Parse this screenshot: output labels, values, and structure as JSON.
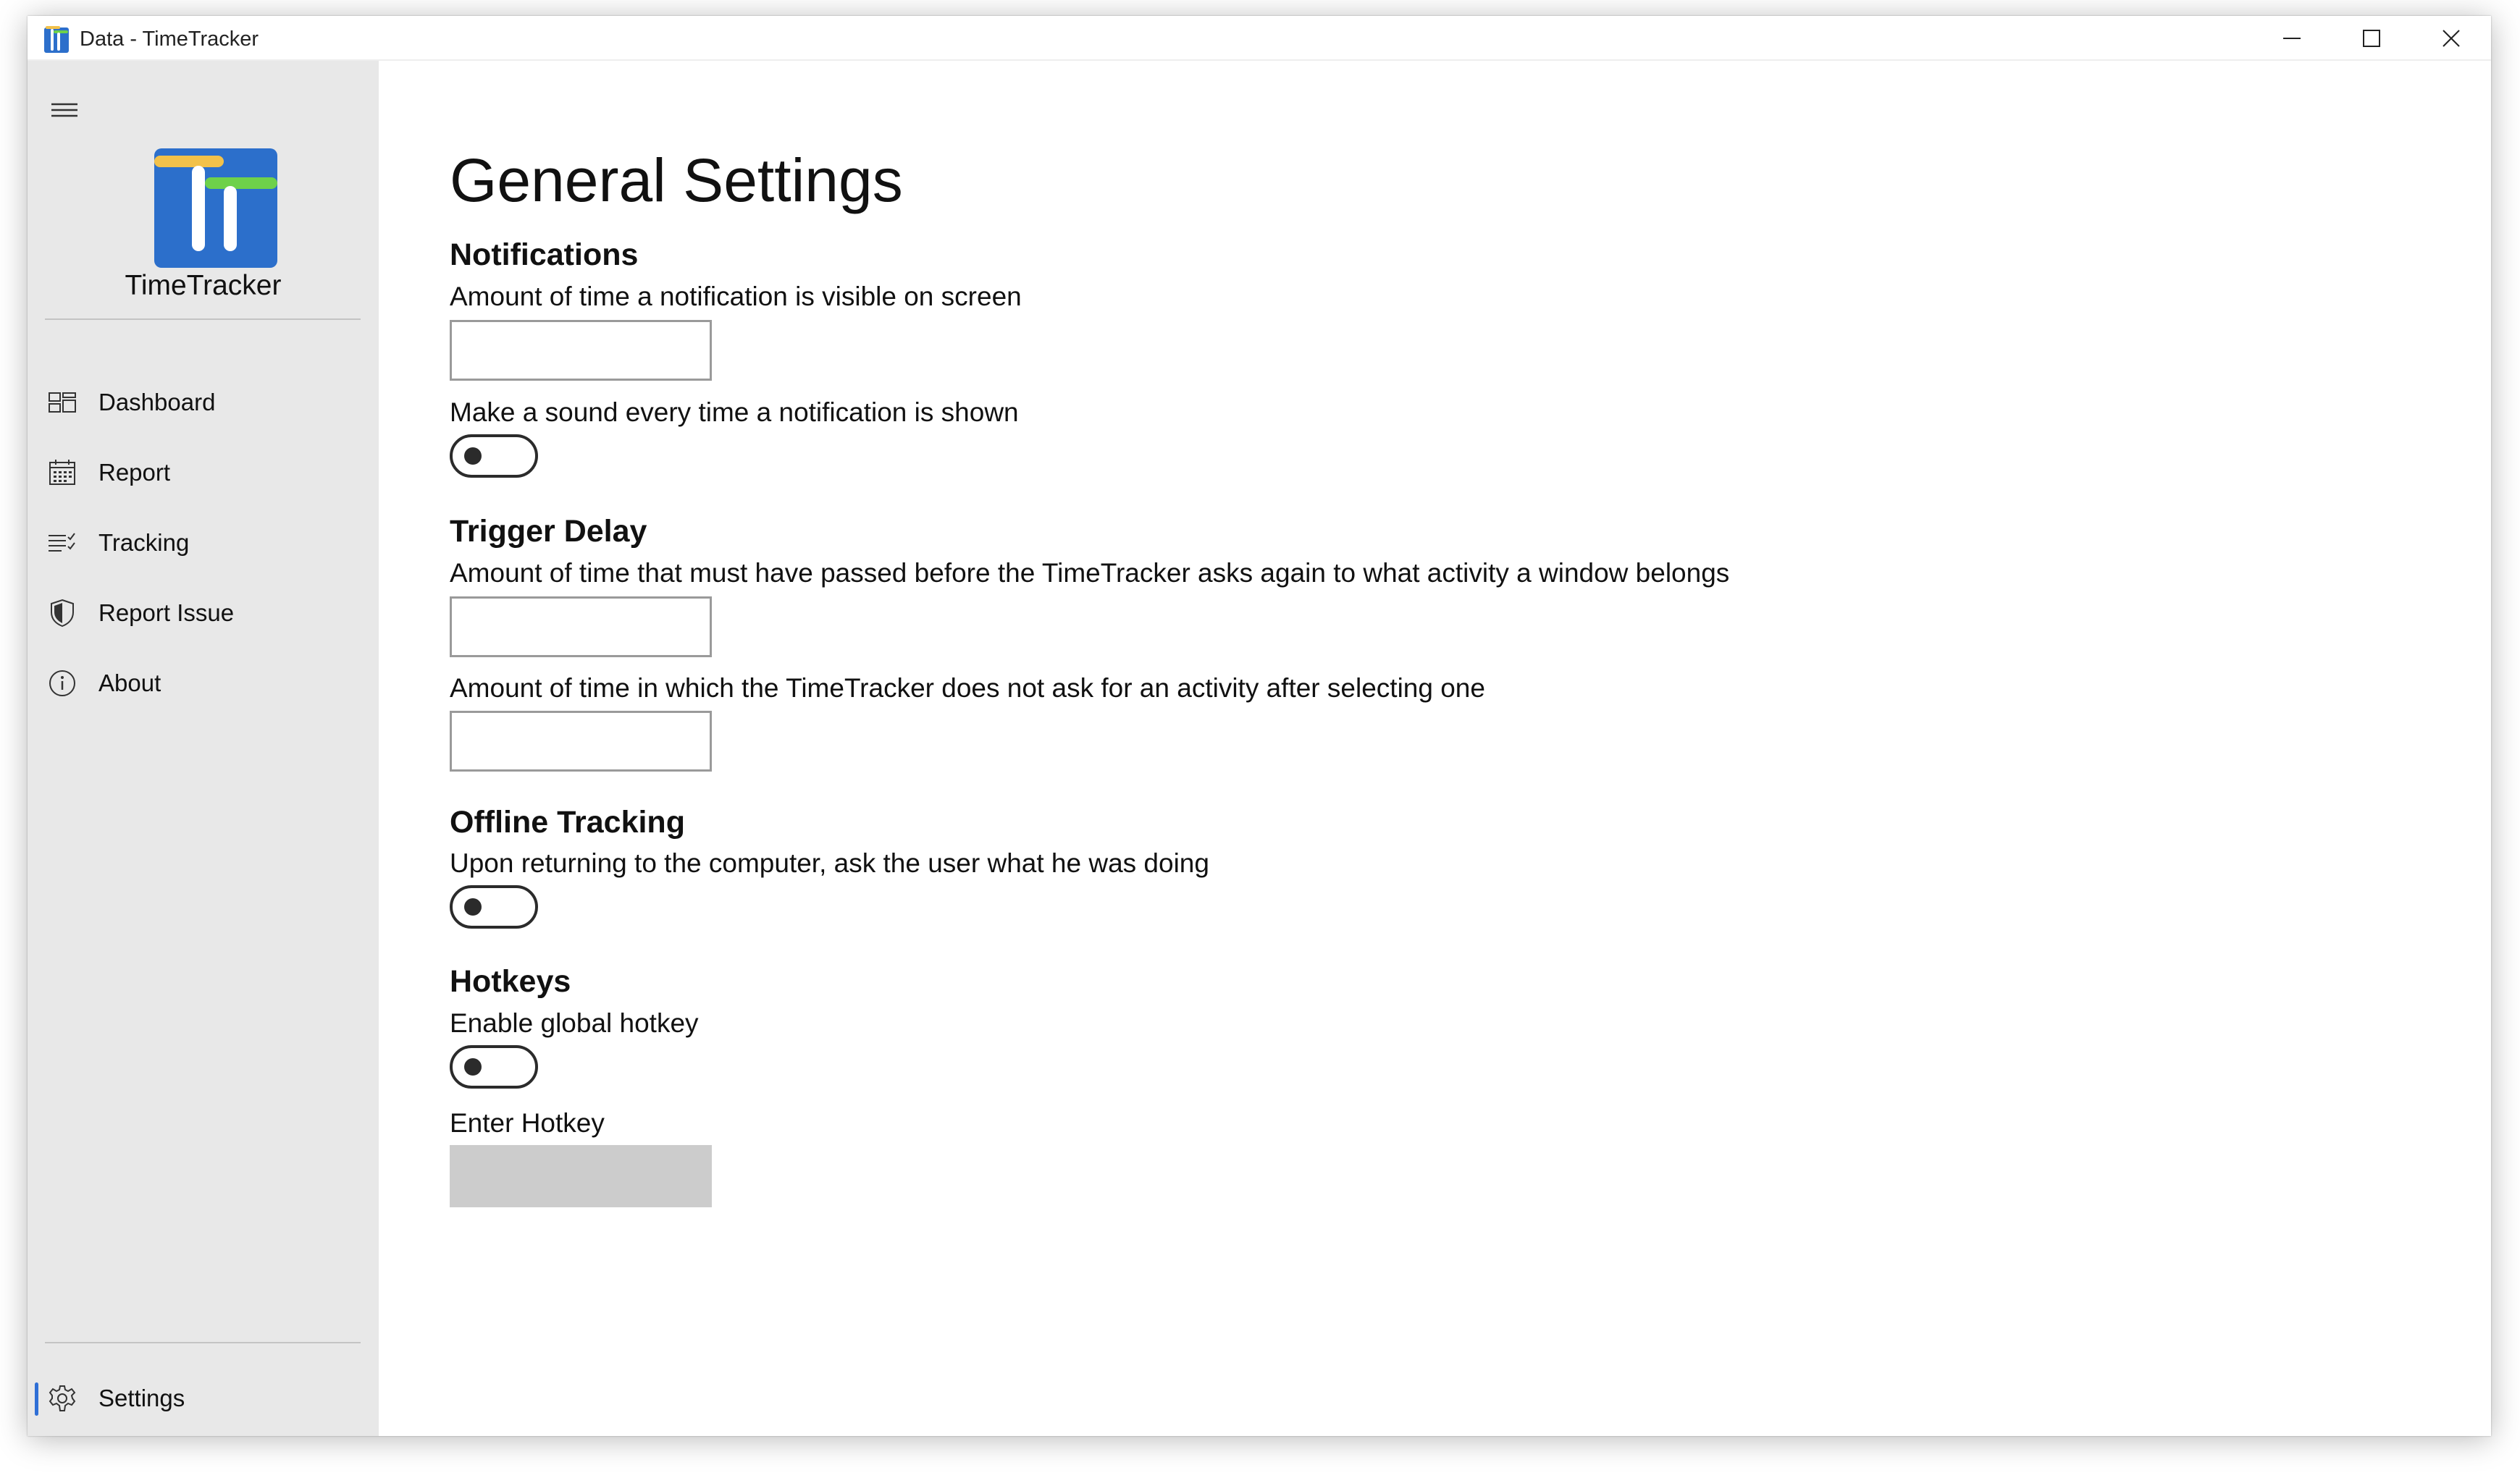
{
  "window": {
    "title": "Data - TimeTracker",
    "controls": {
      "minimize_icon": "minimize-icon",
      "maximize_icon": "maximize-icon",
      "close_icon": "close-icon"
    }
  },
  "colors": {
    "sidebar_bg": "#e8e8e8",
    "accent": "#2f6fd6",
    "logo_blue": "#2c6fcb",
    "logo_yellow": "#f2c14a",
    "logo_green": "#6ed14a",
    "hotkey_bg": "#cccccc"
  },
  "sidebar": {
    "menu_icon": "hamburger-icon",
    "app_name": "TimeTracker",
    "items": [
      {
        "label": "Dashboard",
        "icon": "dashboard-icon"
      },
      {
        "label": "Report",
        "icon": "calendar-icon"
      },
      {
        "label": "Tracking",
        "icon": "checklist-icon"
      },
      {
        "label": "Report Issue",
        "icon": "shield-icon"
      },
      {
        "label": "About",
        "icon": "info-icon"
      }
    ],
    "footer_item": {
      "label": "Settings",
      "icon": "gear-icon",
      "selected": true
    }
  },
  "main": {
    "title": "General Settings",
    "sections": {
      "notifications": {
        "title": "Notifications",
        "visible_time_label": "Amount of time a notification is visible on screen",
        "visible_time_value": "",
        "sound_label": "Make a sound every time a notification is shown",
        "sound_on": false
      },
      "trigger_delay": {
        "title": "Trigger Delay",
        "ask_again_label": "Amount of time that must have passed before the TimeTracker asks again to what activity a window belongs",
        "ask_again_value": "",
        "no_ask_label": "Amount of time in which the TimeTracker does not ask for an activity after selecting one",
        "no_ask_value": ""
      },
      "offline_tracking": {
        "title": "Offline Tracking",
        "ask_label": "Upon returning to the computer, ask the user what he was doing",
        "ask_on": false
      },
      "hotkeys": {
        "title": "Hotkeys",
        "enable_label": "Enable global hotkey",
        "enable_on": false,
        "enter_label": "Enter Hotkey",
        "enter_value": ""
      }
    }
  }
}
